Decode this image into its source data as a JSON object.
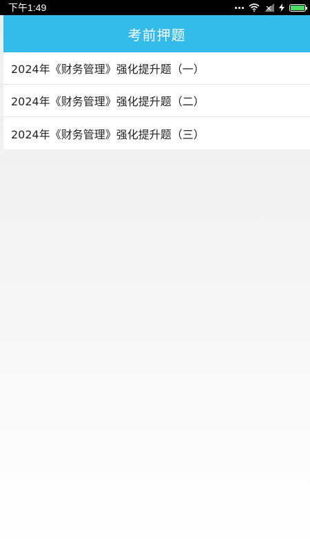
{
  "status_bar": {
    "time": "下午1:49",
    "icons": [
      "more-dots-icon",
      "wifi-icon",
      "signal-icon",
      "charging-icon",
      "battery-icon"
    ],
    "battery_color": "#4cd964"
  },
  "header": {
    "title": "考前押题",
    "background": "#33bbea"
  },
  "list": {
    "items": [
      {
        "label": "2024年《财务管理》强化提升题（一）"
      },
      {
        "label": "2024年《财务管理》强化提升题（二）"
      },
      {
        "label": "2024年《财务管理》强化提升题（三）"
      }
    ]
  }
}
